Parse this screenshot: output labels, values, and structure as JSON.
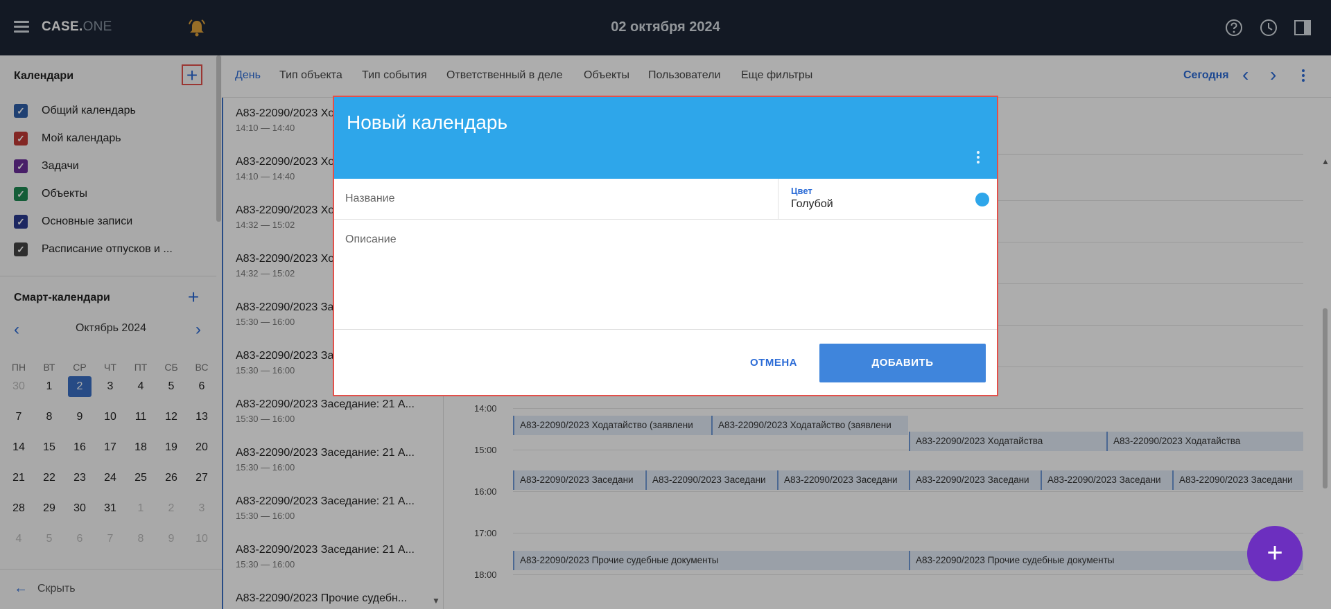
{
  "header": {
    "logo_main": "CASE.",
    "logo_dim": "ONE",
    "date": "02 октября 2024"
  },
  "sidebar": {
    "calendars_title": "Календари",
    "calendars": [
      {
        "label": "Общий календарь",
        "color": "#2f5fa8"
      },
      {
        "label": "Мой календарь",
        "color": "#c23a36"
      },
      {
        "label": "Задачи",
        "color": "#6a2f9a"
      },
      {
        "label": "Объекты",
        "color": "#1e8a53"
      },
      {
        "label": "Основные записи",
        "color": "#2a3a8f"
      },
      {
        "label": "Расписание отпусков и ...",
        "color": "#444444"
      }
    ],
    "smart_title": "Смарт-календари",
    "month_label": "Октябрь 2024",
    "weekdays": [
      "ПН",
      "ВТ",
      "СР",
      "ЧТ",
      "ПТ",
      "СБ",
      "ВС"
    ],
    "weeks": [
      [
        "30",
        "1",
        "2",
        "3",
        "4",
        "5",
        "6"
      ],
      [
        "7",
        "8",
        "9",
        "10",
        "11",
        "12",
        "13"
      ],
      [
        "14",
        "15",
        "16",
        "17",
        "18",
        "19",
        "20"
      ],
      [
        "21",
        "22",
        "23",
        "24",
        "25",
        "26",
        "27"
      ],
      [
        "28",
        "29",
        "30",
        "31",
        "1",
        "2",
        "3"
      ],
      [
        "4",
        "5",
        "6",
        "7",
        "8",
        "9",
        "10"
      ]
    ],
    "hide_label": "Скрыть"
  },
  "filters": {
    "items": [
      "День",
      "Тип объекта",
      "Тип события",
      "Ответственный в деле",
      "Объекты",
      "Пользователи",
      "Еще фильтры"
    ],
    "today": "Сегодня"
  },
  "events": [
    {
      "title": "А83-22090/2023 Хо",
      "time": "14:10 — 14:40"
    },
    {
      "title": "А83-22090/2023 Хо",
      "time": "14:10 — 14:40"
    },
    {
      "title": "А83-22090/2023 Хо",
      "time": "14:32 — 15:02"
    },
    {
      "title": "А83-22090/2023 Хо",
      "time": "14:32 — 15:02"
    },
    {
      "title": "А83-22090/2023 За",
      "time": "15:30 — 16:00"
    },
    {
      "title": "А83-22090/2023 За",
      "time": "15:30 — 16:00"
    },
    {
      "title": "А83-22090/2023 Заседание: 21 А...",
      "time": "15:30 — 16:00"
    },
    {
      "title": "А83-22090/2023 Заседание: 21 А...",
      "time": "15:30 — 16:00"
    },
    {
      "title": "А83-22090/2023 Заседание: 21 А...",
      "time": "15:30 — 16:00"
    },
    {
      "title": "А83-22090/2023 Заседание: 21 А...",
      "time": "15:30 — 16:00"
    },
    {
      "title": "А83-22090/2023 Прочие судебн...",
      "time": ""
    }
  ],
  "timeline": {
    "hours": [
      "14:00",
      "15:00",
      "16:00",
      "17:00",
      "18:00"
    ],
    "events": [
      "А83-22090/2023 Ходатайство (заявлени",
      "А83-22090/2023 Ходатайство (заявлени",
      "А83-22090/2023 Ходатайства",
      "А83-22090/2023 Ходатайства",
      "А83-22090/2023 Заседани",
      "А83-22090/2023 Заседани",
      "А83-22090/2023 Заседани",
      "А83-22090/2023 Заседани",
      "А83-22090/2023 Заседани",
      "А83-22090/2023 Заседани",
      "А83-22090/2023 Прочие судебные документы",
      "А83-22090/2023 Прочие судебные документы"
    ]
  },
  "dialog": {
    "title": "Новый календарь",
    "name_placeholder": "Название",
    "color_label": "Цвет",
    "color_value": "Голубой",
    "color_swatch": "#2ea6ea",
    "description_placeholder": "Описание",
    "cancel": "ОТМЕНА",
    "add": "ДОБАВИТЬ"
  }
}
